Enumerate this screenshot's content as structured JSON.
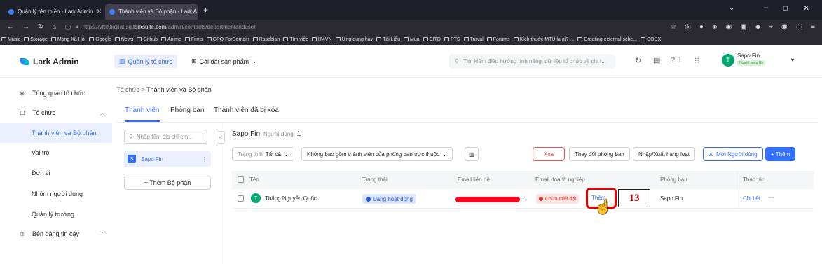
{
  "browser": {
    "tabs": [
      {
        "title": "Quản lý tên miền - Lark Admin"
      },
      {
        "title": "Thành viên và Bộ phận - Lark A"
      }
    ],
    "new_tab": "+",
    "url_prefix": "https://vftk0kqiiat.sg.",
    "url_domain": "larksuite.com",
    "url_path": "/admin/contacts/departmentanduser",
    "bookmarks": [
      "Music",
      "Storage",
      "Mạng Xã Hội",
      "Google",
      "News",
      "Github",
      "Anime",
      "Films",
      "GPO ForDomain",
      "Raspbian",
      "Tìm việc",
      "IT4VN",
      "Ứng dụng hay",
      "Tài Liệu",
      "Mua",
      "CITD",
      "PTS",
      "Traval",
      "Forums",
      "Kích thuớc MTU là gì? ...",
      "Creating external sche...",
      "CODX"
    ]
  },
  "header": {
    "logo": "Lark Admin",
    "nav_org": "Quản lý tổ chức",
    "nav_products": "Cài đặt sản phẩm",
    "search_placeholder": "Tìm kiếm điều hướng tính năng, dữ liệu tổ chức và chi t...",
    "user_name": "Sapo Fin",
    "user_badge": "Người sáng lập",
    "avatar_letter": "T"
  },
  "sidebar": {
    "overview": "Tổng quan tổ chức",
    "org": "Tổ chức",
    "items": [
      "Thành viên và Bộ phận",
      "Vai trò",
      "Đơn vị",
      "Nhóm người dùng",
      "Quản lý trường"
    ],
    "trusted": "Bên đáng tin cậy"
  },
  "breadcrumb": {
    "parent": "Tổ chức",
    "sep": ">",
    "current": "Thành viên và Bộ phận"
  },
  "tabs": [
    "Thành viên",
    "Phòng ban",
    "Thành viên đã bị xóa"
  ],
  "left_panel": {
    "search_placeholder": "Nhập tên, địa chỉ em...",
    "collapse": "<",
    "dept_letter": "S",
    "dept_name": "Sapo Fin",
    "dept_more": "⋮",
    "add_dept": "+ Thêm Bộ phận"
  },
  "dept_header": {
    "name": "Sapo Fin",
    "count_label": "Người dùng",
    "count": "1"
  },
  "filters": {
    "status_label": "Trạng thái",
    "status_value": "Tất cả",
    "exclude": "Không bao gồm thành viên của phòng ban trực thuộc"
  },
  "actions": {
    "delete": "Xóa",
    "change_dept": "Thay đổi phòng ban",
    "import_export": "Nhập/Xuất hàng loạt",
    "invite": "Mời Người dùng",
    "add": "+ Thêm"
  },
  "table": {
    "headers": [
      "Tên",
      "Trạng thái",
      "Email liên hệ",
      "Email doanh nghiệp",
      "Phòng ban",
      "Thao tác"
    ],
    "row": {
      "avatar": "T",
      "name": "Thắng Nguyễn Quốc",
      "status": "Đang hoạt động",
      "contact_email_tail": "...",
      "biz_email_status": "Chưa thiết đặt",
      "biz_email_add": "Thêm",
      "department": "Sapo Fin",
      "detail": "Chi tiết",
      "more": "···"
    }
  },
  "annotation": {
    "step": "13",
    "highlight_color": "#e60000"
  },
  "colors": {
    "primary": "#3370ff",
    "danger": "#f54a45",
    "success": "#00a870"
  }
}
